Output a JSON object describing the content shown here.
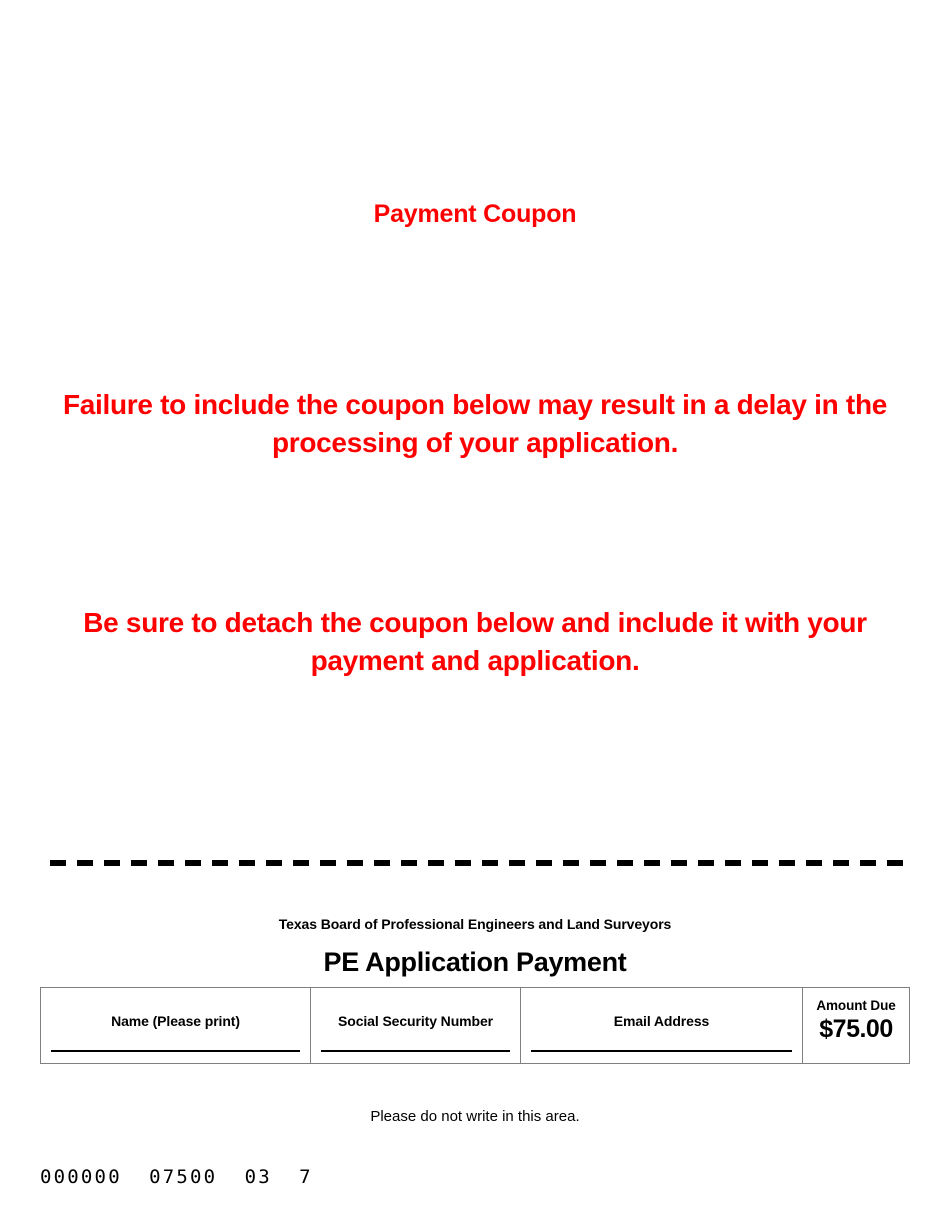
{
  "document": {
    "heading": "Payment Coupon",
    "notices": [
      "Failure to include the coupon below may result in a delay in the processing of your application.",
      "Be sure to detach the coupon below and include it with your payment and application."
    ],
    "notice_color": "#ff0000"
  },
  "tear_line": {
    "style": "dashed-cut-line"
  },
  "coupon": {
    "organization": "Texas Board of Professional Engineers and Land Surveyors",
    "title": "PE Application Payment",
    "fields": [
      {
        "label": "Name (Please print)",
        "value": ""
      },
      {
        "label": "Social Security Number",
        "value": ""
      },
      {
        "label": "Email Address",
        "value": ""
      }
    ],
    "amount": {
      "label": "Amount Due",
      "value": "$75.00"
    }
  },
  "footer": {
    "notice": "Please do not write in this area.",
    "scanline": "000000  07500  03  7"
  }
}
